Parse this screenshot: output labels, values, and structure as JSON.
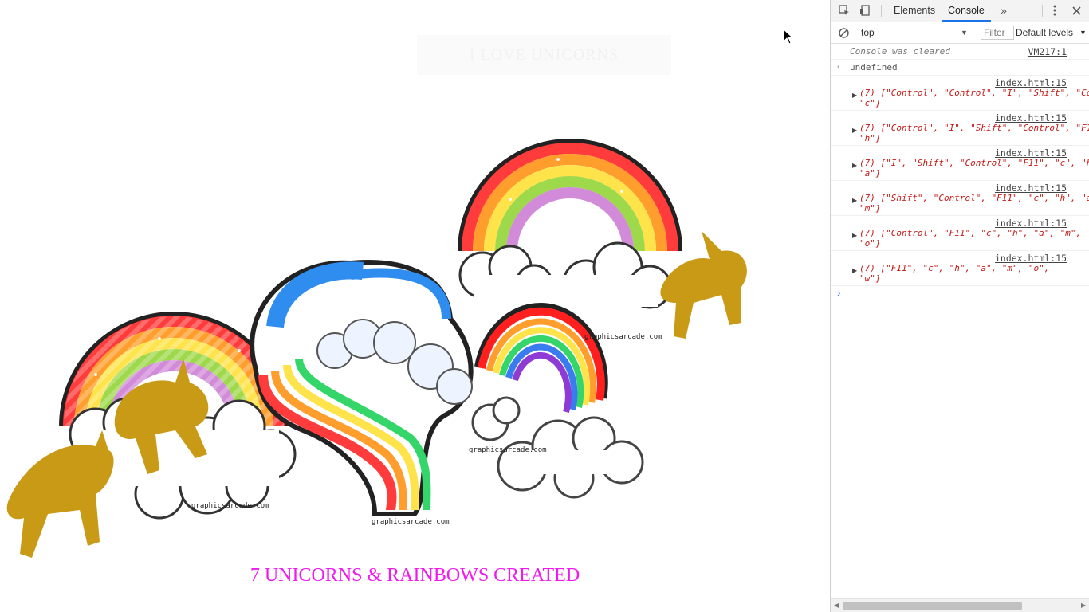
{
  "page": {
    "faded_banner": "I LOVE UNICORNS",
    "caption": "7 UNICORNS & RAINBOWS CREATED",
    "watermarks": [
      "graphicsarcade.com",
      "graphicsarcade.com",
      "graphicsarcade.com",
      "graphicsarcade.com"
    ],
    "caption_color": "#f01aef"
  },
  "devtools": {
    "tabs": [
      {
        "label": "Elements"
      },
      {
        "label": "Console",
        "active": true
      }
    ],
    "more_tabs": "»",
    "context": "top",
    "filter_placeholder": "Filter",
    "levels": "Default levels",
    "console": {
      "cleared_text": "Console was cleared",
      "cleared_source": "VM217:1",
      "undefined_text": "undefined",
      "logs": [
        {
          "source": "index.html:15",
          "line1": "(7) [\"Control\", \"Control\", \"I\", \"Shift\", \"Co",
          "line2": "\"c\"]"
        },
        {
          "source": "index.html:15",
          "line1": "(7) [\"Control\", \"I\", \"Shift\", \"Control\", \"F1",
          "line2": "\"h\"]"
        },
        {
          "source": "index.html:15",
          "line1": "(7) [\"I\", \"Shift\", \"Control\", \"F11\", \"c\", \"h",
          "line2": "\"a\"]"
        },
        {
          "source": "index.html:15",
          "line1": "(7) [\"Shift\", \"Control\", \"F11\", \"c\", \"h\", \"a",
          "line2": "\"m\"]"
        },
        {
          "source": "index.html:15",
          "line1": "(7) [\"Control\", \"F11\", \"c\", \"h\", \"a\", \"m\",",
          "line2": "\"o\"]"
        },
        {
          "source": "index.html:15",
          "line1": "(7) [\"F11\", \"c\", \"h\", \"a\", \"m\", \"o\",",
          "line2": "\"w\"]"
        }
      ]
    },
    "accent_color": "#1a73e8"
  }
}
